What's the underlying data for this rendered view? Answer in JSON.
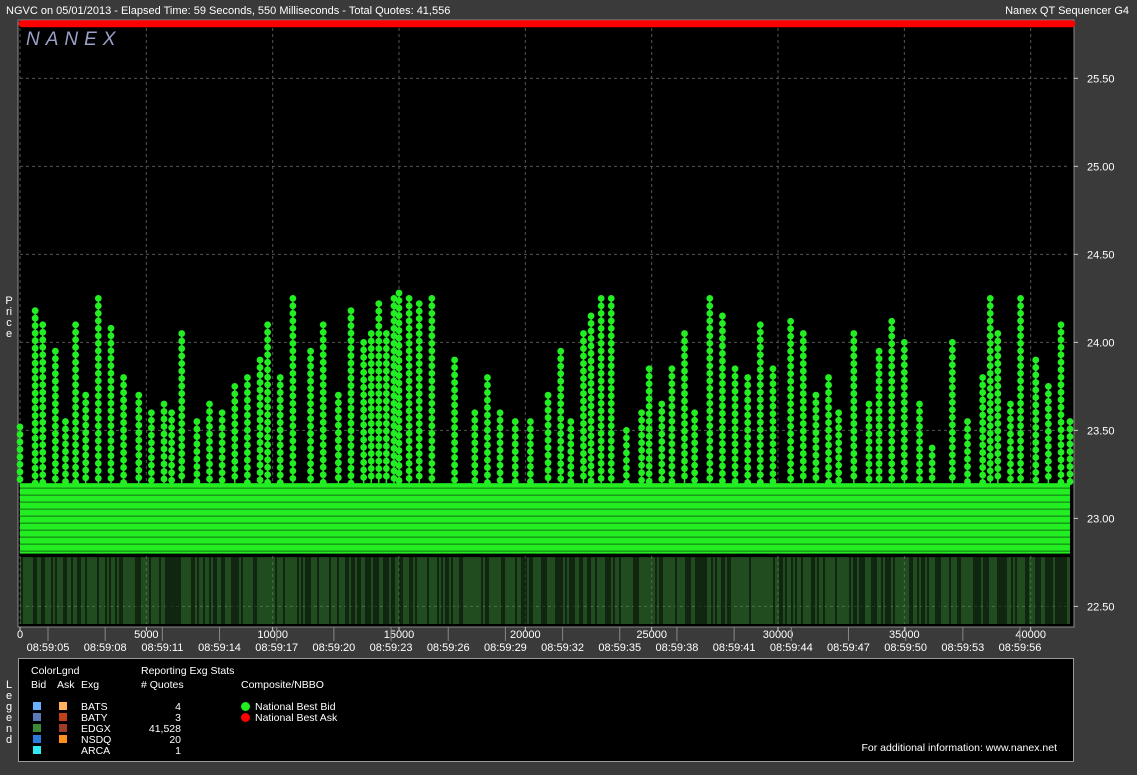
{
  "header": {
    "left": "NGVC on 05/01/2013  -  Elapsed Time: 59 Seconds, 550 Milliseconds  -  Total Quotes: 41,556",
    "right": "Nanex QT Sequencer G4"
  },
  "watermark": "NANEX",
  "side_labels": {
    "price": "Price",
    "legend": "Legend"
  },
  "colors": {
    "bid": "#22ee22",
    "ask": "#ff0000",
    "background": "#000000",
    "frame": "#3a3a3a",
    "volume": "#3a8a3a"
  },
  "chart_data": {
    "type": "scatter",
    "ylabel": "Price",
    "ylim": [
      22.4,
      25.82
    ],
    "xlim": [
      0,
      41556
    ],
    "y_ticks": [
      "25.50",
      "25.00",
      "24.50",
      "24.00",
      "23.50",
      "23.00",
      "22.50"
    ],
    "x_ticks": [
      "0",
      "5000",
      "10000",
      "15000",
      "20000",
      "25000",
      "30000",
      "35000",
      "40000"
    ],
    "time_ticks": [
      "08:59:05",
      "08:59:08",
      "08:59:11",
      "08:59:14",
      "08:59:17",
      "08:59:20",
      "08:59:23",
      "08:59:26",
      "08:59:29",
      "08:59:32",
      "08:59:35",
      "08:59:38",
      "08:59:41",
      "08:59:44",
      "08:59:47",
      "08:59:50",
      "08:59:53",
      "08:59:56"
    ],
    "series": [
      {
        "name": "National Best Ask",
        "color": "#ff0000",
        "price": 25.81
      },
      {
        "name": "National Best Bid",
        "color": "#22ee22",
        "band_low": 22.8,
        "band_high": 23.2,
        "spikes": [
          [
            0,
            23.52
          ],
          [
            600,
            24.18
          ],
          [
            900,
            24.1
          ],
          [
            1400,
            23.95
          ],
          [
            1800,
            23.55
          ],
          [
            2200,
            24.1
          ],
          [
            2600,
            23.7
          ],
          [
            3100,
            24.25
          ],
          [
            3600,
            24.08
          ],
          [
            4100,
            23.8
          ],
          [
            4700,
            23.7
          ],
          [
            5200,
            23.6
          ],
          [
            5700,
            23.65
          ],
          [
            6000,
            23.6
          ],
          [
            6400,
            24.05
          ],
          [
            7000,
            23.55
          ],
          [
            7500,
            23.65
          ],
          [
            8000,
            23.6
          ],
          [
            8500,
            23.75
          ],
          [
            9000,
            23.8
          ],
          [
            9500,
            23.9
          ],
          [
            9800,
            24.1
          ],
          [
            10300,
            23.8
          ],
          [
            10800,
            24.25
          ],
          [
            11500,
            23.95
          ],
          [
            12000,
            24.1
          ],
          [
            12600,
            23.7
          ],
          [
            13100,
            24.18
          ],
          [
            13600,
            24.0
          ],
          [
            13900,
            24.05
          ],
          [
            14200,
            24.22
          ],
          [
            14500,
            24.05
          ],
          [
            14800,
            24.25
          ],
          [
            15000,
            24.28
          ],
          [
            15400,
            24.25
          ],
          [
            15800,
            24.22
          ],
          [
            16300,
            24.25
          ],
          [
            17200,
            23.9
          ],
          [
            18000,
            23.6
          ],
          [
            18500,
            23.8
          ],
          [
            19000,
            23.6
          ],
          [
            19600,
            23.55
          ],
          [
            20200,
            23.55
          ],
          [
            20900,
            23.7
          ],
          [
            21400,
            23.95
          ],
          [
            21800,
            23.55
          ],
          [
            22300,
            24.05
          ],
          [
            22600,
            24.15
          ],
          [
            23000,
            24.25
          ],
          [
            23400,
            24.25
          ],
          [
            24000,
            23.5
          ],
          [
            24600,
            23.6
          ],
          [
            24900,
            23.85
          ],
          [
            25400,
            23.65
          ],
          [
            25800,
            23.85
          ],
          [
            26300,
            24.05
          ],
          [
            26700,
            23.6
          ],
          [
            27300,
            24.25
          ],
          [
            27800,
            24.15
          ],
          [
            28300,
            23.85
          ],
          [
            28800,
            23.8
          ],
          [
            29300,
            24.1
          ],
          [
            29800,
            23.85
          ],
          [
            30500,
            24.12
          ],
          [
            31000,
            24.05
          ],
          [
            31500,
            23.7
          ],
          [
            32000,
            23.8
          ],
          [
            32400,
            23.6
          ],
          [
            33000,
            24.05
          ],
          [
            33600,
            23.65
          ],
          [
            34000,
            23.95
          ],
          [
            34500,
            24.12
          ],
          [
            35000,
            24.0
          ],
          [
            35600,
            23.65
          ],
          [
            36100,
            23.4
          ],
          [
            36900,
            24.0
          ],
          [
            37500,
            23.55
          ],
          [
            38100,
            23.8
          ],
          [
            38400,
            24.25
          ],
          [
            38700,
            24.05
          ],
          [
            39200,
            23.65
          ],
          [
            39600,
            24.25
          ],
          [
            40200,
            23.9
          ],
          [
            40700,
            23.75
          ],
          [
            41200,
            24.1
          ],
          [
            41556,
            23.55
          ]
        ]
      }
    ]
  },
  "legend": {
    "col_color": "ColorLgnd",
    "col_bid": "Bid",
    "col_ask": "Ask",
    "col_exg": "Exg",
    "stats_title": "Reporting Exg Stats",
    "col_quotes": "# Quotes",
    "composite_title": "Composite/NBBO",
    "exchanges": [
      {
        "name": "BATS",
        "quotes": "4",
        "bid_color": "#6ab0ff",
        "ask_color": "#ffb060"
      },
      {
        "name": "BATY",
        "quotes": "3",
        "bid_color": "#5a7ab8",
        "ask_color": "#c0401a"
      },
      {
        "name": "EDGX",
        "quotes": "41,528",
        "bid_color": "#3a8a3a",
        "ask_color": "#a03a2a"
      },
      {
        "name": "NSDQ",
        "quotes": "20",
        "bid_color": "#2a7ae0",
        "ask_color": "#ff9020"
      },
      {
        "name": "ARCA",
        "quotes": "1",
        "bid_color": "#30e8f0",
        "ask_color": ""
      }
    ],
    "nbbo": [
      {
        "label": "National Best Bid",
        "color": "#22ee22"
      },
      {
        "label": "National Best Ask",
        "color": "#ff0000"
      }
    ],
    "footer": "For additional information: www.nanex.net"
  }
}
